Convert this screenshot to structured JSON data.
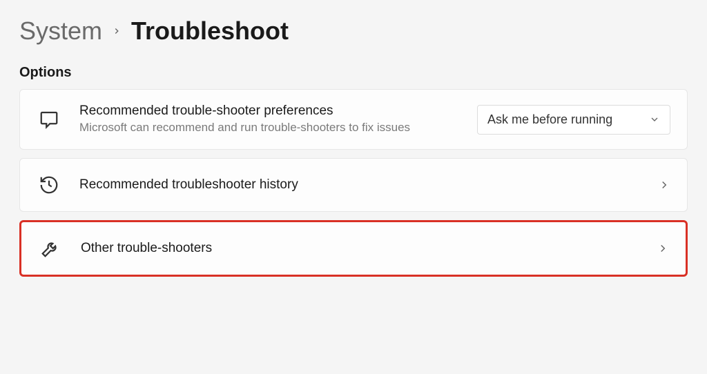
{
  "breadcrumb": {
    "parent": "System",
    "current": "Troubleshoot"
  },
  "section": {
    "title": "Options"
  },
  "preferences": {
    "title": "Recommended trouble-shooter preferences",
    "desc": "Microsoft can recommend and run trouble-shooters to fix issues",
    "selected": "Ask me before running"
  },
  "history": {
    "title": "Recommended troubleshooter history"
  },
  "other": {
    "title": "Other trouble-shooters"
  }
}
